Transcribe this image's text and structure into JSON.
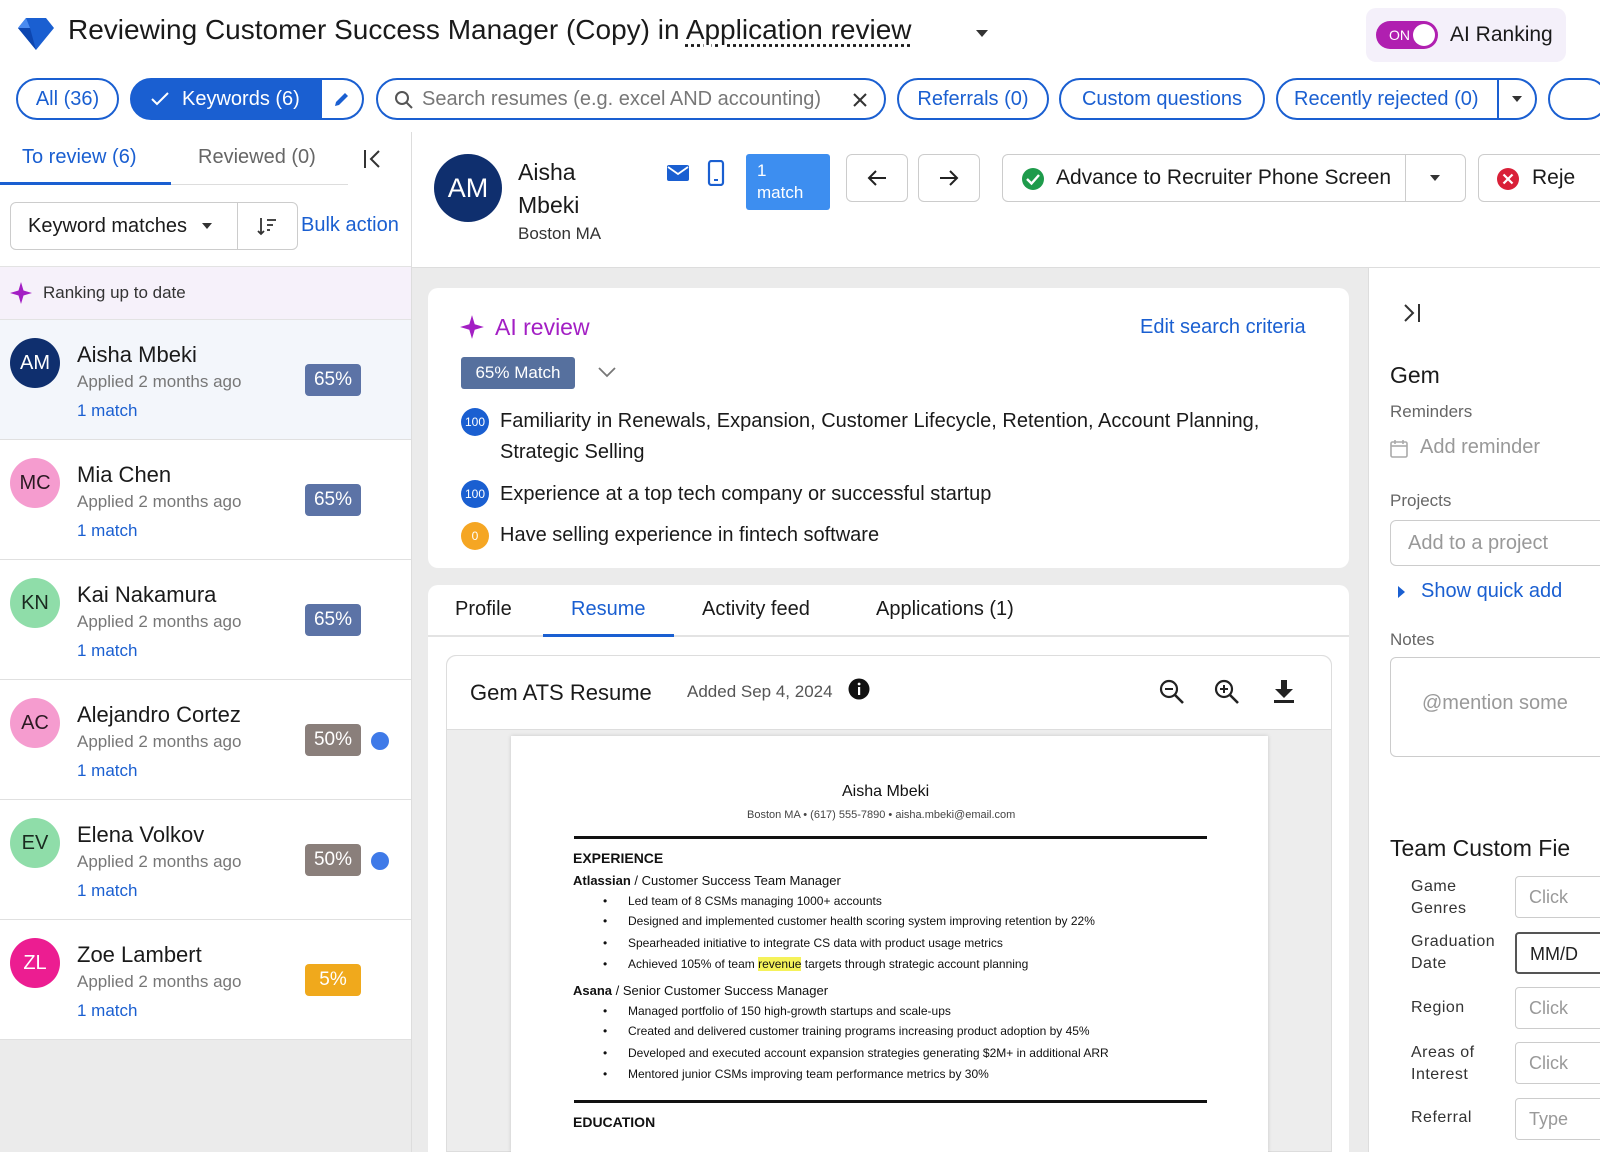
{
  "header": {
    "title_prefix": "Reviewing Customer Success Manager (Copy) in ",
    "title_link": "Application review",
    "ai_ranking": {
      "toggle_state": "ON",
      "label": "AI Ranking"
    }
  },
  "filters": {
    "all": "All (36)",
    "keywords": "Keywords (6)",
    "search_placeholder": "Search resumes (e.g. excel AND accounting)",
    "referrals": "Referrals (0)",
    "custom_questions": "Custom questions",
    "recently_rejected": "Recently rejected (0)"
  },
  "left_panel": {
    "tabs": {
      "to_review": "To review (6)",
      "reviewed": "Reviewed (0)"
    },
    "sort_label": "Keyword matches",
    "bulk_action": "Bulk action",
    "ranking_status": "Ranking up to date",
    "candidates": [
      {
        "initials": "AM",
        "name": "Aisha Mbeki",
        "applied": "Applied 2 months ago",
        "match": "1 match",
        "score": "65%",
        "avatar_bg": "#0f2f6e",
        "avatar_fg": "#ffffff",
        "score_bg": "#5c73a6",
        "unread": false
      },
      {
        "initials": "MC",
        "name": "Mia Chen",
        "applied": "Applied 2 months ago",
        "match": "1 match",
        "score": "65%",
        "avatar_bg": "#f59ccf",
        "avatar_fg": "#2a1a22",
        "score_bg": "#5c73a6",
        "unread": false
      },
      {
        "initials": "KN",
        "name": "Kai Nakamura",
        "applied": "Applied 2 months ago",
        "match": "1 match",
        "score": "65%",
        "avatar_bg": "#8fdda9",
        "avatar_fg": "#1a2a20",
        "score_bg": "#5c73a6",
        "unread": false
      },
      {
        "initials": "AC",
        "name": "Alejandro Cortez",
        "applied": "Applied 2 months ago",
        "match": "1 match",
        "score": "50%",
        "avatar_bg": "#f59ccf",
        "avatar_fg": "#2a1a22",
        "score_bg": "#8a7f7b",
        "unread": true
      },
      {
        "initials": "EV",
        "name": "Elena Volkov",
        "applied": "Applied 2 months ago",
        "match": "1 match",
        "score": "50%",
        "avatar_bg": "#8fdda9",
        "avatar_fg": "#1a2a20",
        "score_bg": "#8a7f7b",
        "unread": true
      },
      {
        "initials": "ZL",
        "name": "Zoe Lambert",
        "applied": "Applied 2 months ago",
        "match": "1 match",
        "score": "5%",
        "avatar_bg": "#ec1d91",
        "avatar_fg": "#ffffff",
        "score_bg": "#f0a91c",
        "unread": false
      }
    ]
  },
  "candidate": {
    "initials": "AM",
    "first_name": "Aisha",
    "last_name": "Mbeki",
    "location": "Boston MA",
    "match_badge_count": "1",
    "match_badge_word": "match",
    "advance_label": "Advance to Recruiter Phone Screen",
    "reject_label": "Reje"
  },
  "ai_review": {
    "title": "AI review",
    "edit_link": "Edit search criteria",
    "match_score": "65% Match",
    "criteria": [
      {
        "score": "100",
        "color": "#1a5fd1",
        "text": "Familiarity in Renewals, Expansion, Customer Lifecycle, Retention, Account Planning, Strategic Selling"
      },
      {
        "score": "100",
        "color": "#1a5fd1",
        "text": "Experience at a top tech company or successful startup"
      },
      {
        "score": "0",
        "color": "#f5a623",
        "text": "Have selling experience in fintech software"
      }
    ]
  },
  "tabs": [
    "Profile",
    "Resume",
    "Activity feed",
    "Applications (1)"
  ],
  "resume": {
    "title": "Gem ATS Resume",
    "added": "Added Sep 4, 2024",
    "doc": {
      "name": "Aisha Mbeki",
      "contact": "Boston MA  • (617) 555-7890  • aisha.mbeki@email.com",
      "section_experience": "EXPERIENCE",
      "section_education": "EDUCATION",
      "job1_company": "Atlassian",
      "job1_title": " / Customer Success Team Manager",
      "job1_bullets": [
        "Led team of 8 CSMs managing 1000+ accounts",
        "Designed and implemented customer health scoring system improving retention by 22%",
        "Spearheaded initiative to integrate CS data with product usage metrics"
      ],
      "job1_b4_pre": "Achieved 105% of team ",
      "job1_b4_hl": "revenue",
      "job1_b4_post": " targets through strategic account planning",
      "job2_company": "Asana",
      "job2_title": " / Senior Customer Success Manager",
      "job2_bullets": [
        "Managed portfolio of 150 high-growth startups and scale-ups",
        "Created and delivered customer training programs increasing product adoption by 45%",
        "Developed and executed account expansion strategies generating $2M+ in additional ARR",
        "Mentored junior CSMs improving team performance metrics by 30%"
      ]
    }
  },
  "right_panel": {
    "title": "Gem",
    "reminders_label": "Reminders",
    "add_reminder": "Add reminder",
    "projects_label": "Projects",
    "add_project_placeholder": "Add to a project",
    "show_quick_add": "Show quick add",
    "notes_label": "Notes",
    "notes_placeholder": "@mention some",
    "team_fields_title": "Team Custom Fie",
    "fields": [
      {
        "label": "Game Genres",
        "placeholder": "Click"
      },
      {
        "label": "Graduation Date",
        "placeholder": "MM/D"
      },
      {
        "label": "Region",
        "placeholder": "Click"
      },
      {
        "label": "Areas of Interest",
        "placeholder": "Click"
      },
      {
        "label": "Referral",
        "placeholder": "Type"
      }
    ]
  }
}
